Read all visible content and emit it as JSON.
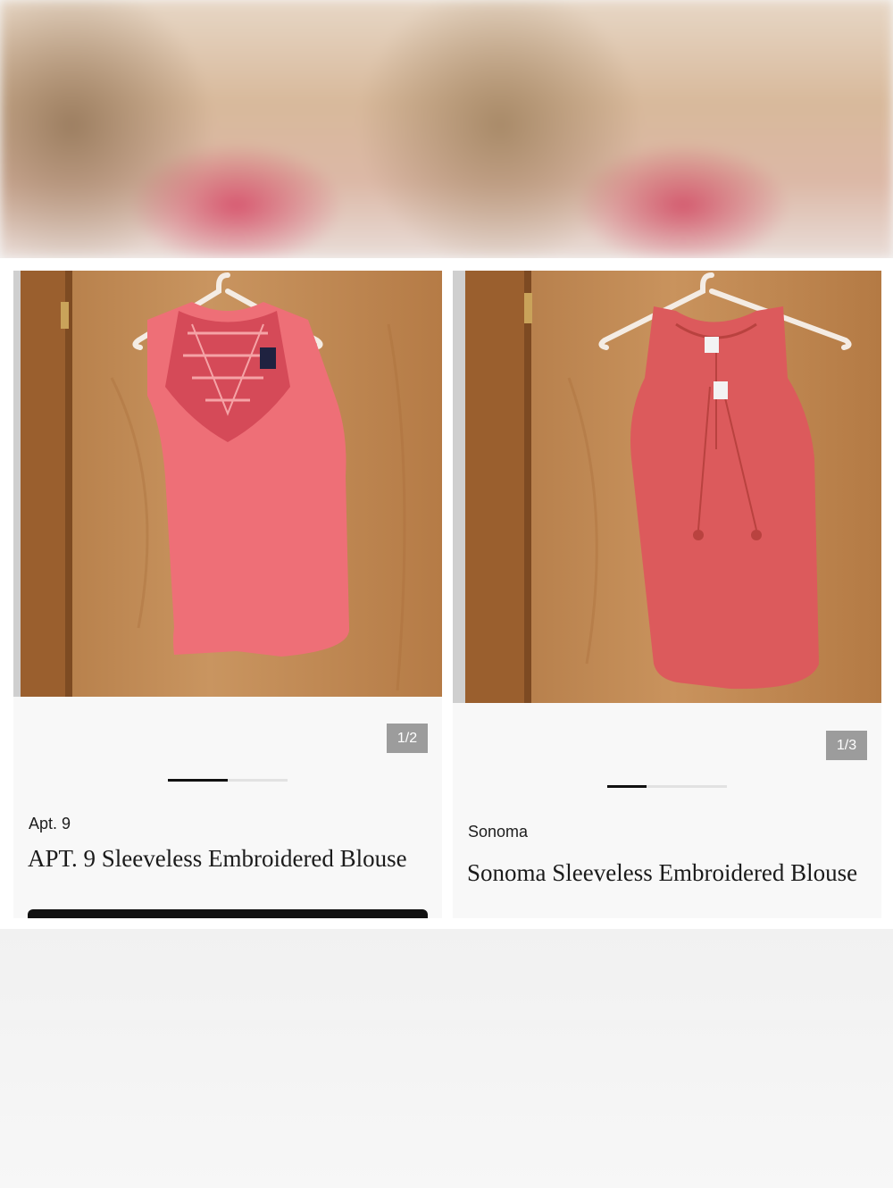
{
  "colors": {
    "accent": "#111111",
    "counter_bg": "#9c9c9c",
    "blouse_left": "#ee6f77",
    "blouse_right": "#dc5a5c"
  },
  "products": [
    {
      "image_counter": "1/2",
      "carousel_progress": 0.5,
      "brand": "Apt. 9",
      "title": "APT. 9 Sleeveless Embroidered Blouse"
    },
    {
      "image_counter": "1/3",
      "carousel_progress": 0.33,
      "brand": "Sonoma",
      "title": "Sonoma Sleeveless Embroidered Blouse"
    }
  ]
}
